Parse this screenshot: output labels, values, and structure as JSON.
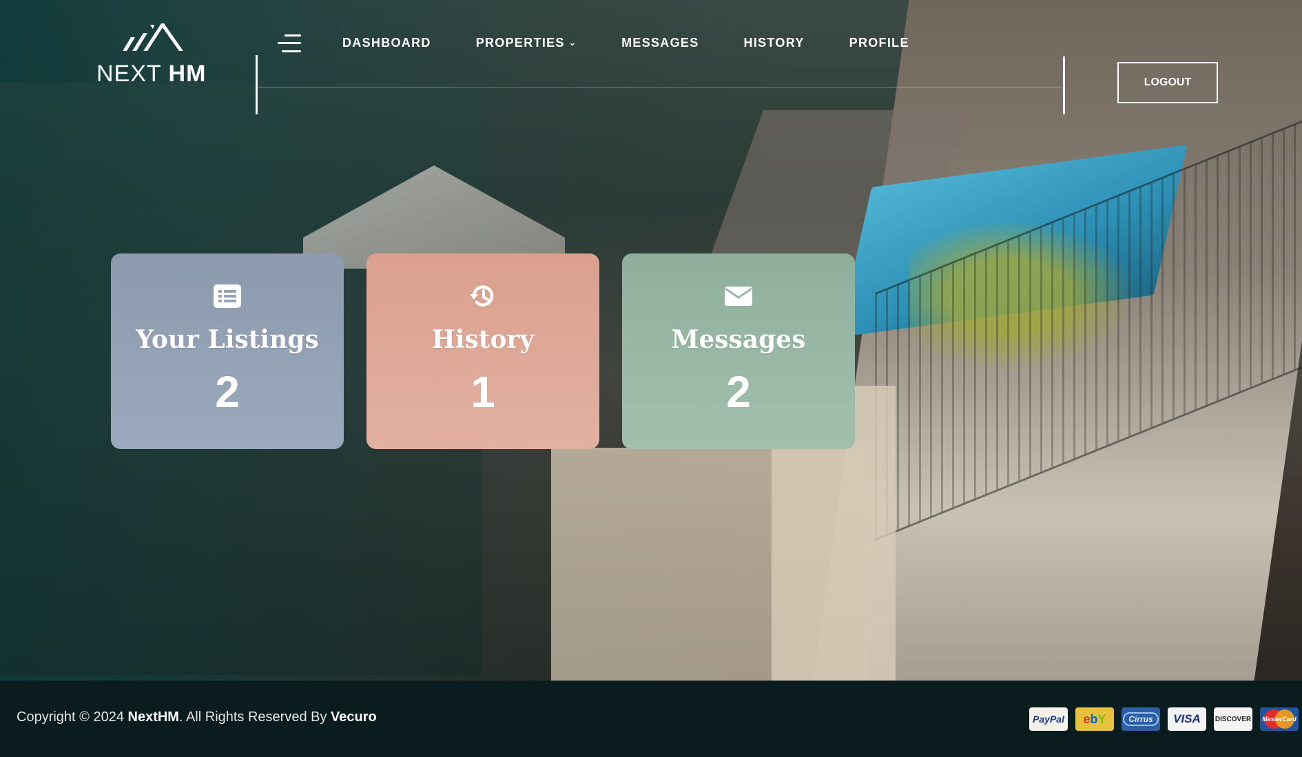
{
  "brand": {
    "name_light": "NEXT",
    "name_bold": "HM"
  },
  "nav": {
    "items": [
      {
        "label": "DASHBOARD"
      },
      {
        "label": "PROPERTIES",
        "has_dropdown": true
      },
      {
        "label": "MESSAGES"
      },
      {
        "label": "HISTORY"
      },
      {
        "label": "PROFILE"
      }
    ],
    "logout_label": "LOGOUT"
  },
  "cards": [
    {
      "title": "Your Listings",
      "count": "2",
      "icon": "list-alt-icon",
      "color": "#95a3b7"
    },
    {
      "title": "History",
      "count": "1",
      "icon": "history-icon",
      "color": "#dfa897"
    },
    {
      "title": "Messages",
      "count": "2",
      "icon": "envelope-icon",
      "color": "#98b7a5"
    }
  ],
  "footer": {
    "copyright_prefix": "Copyright © 2024 ",
    "company": "NextHM",
    "rights_text": ". All Rights Reserved By ",
    "author": "Vecuro",
    "payments": [
      {
        "name": "PayPal",
        "icon": "paypal-icon"
      },
      {
        "name": "ebY",
        "icon": "ebay-icon"
      },
      {
        "name": "Cirrus",
        "icon": "cirrus-icon"
      },
      {
        "name": "VISA",
        "icon": "visa-icon"
      },
      {
        "name": "DISCOVER",
        "icon": "discover-icon"
      },
      {
        "name": "MasterCard",
        "icon": "mastercard-icon"
      }
    ]
  },
  "colors": {
    "footer_bg": "#0b1c1f",
    "overlay_teal": "#0e3a3a"
  }
}
